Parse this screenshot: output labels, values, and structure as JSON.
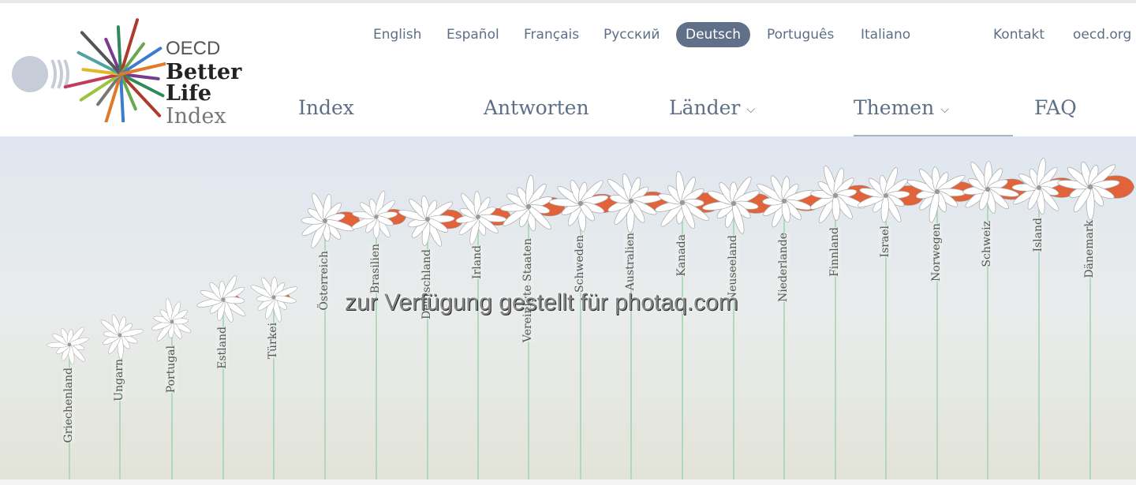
{
  "logo": {
    "oecd": "OECD",
    "line1": "Better Life",
    "line2": "Index"
  },
  "languages": [
    {
      "label": "English",
      "active": false
    },
    {
      "label": "Español",
      "active": false
    },
    {
      "label": "Français",
      "active": false
    },
    {
      "label": "Русский",
      "active": false
    },
    {
      "label": "Deutsch",
      "active": true
    },
    {
      "label": "Português",
      "active": false
    },
    {
      "label": "Italiano",
      "active": false
    }
  ],
  "utility_links": {
    "contact": "Kontakt",
    "site": "oecd.org"
  },
  "nav": [
    {
      "label": "Index",
      "dropdown": false
    },
    {
      "label": "Antworten",
      "dropdown": false
    },
    {
      "label": "Länder",
      "dropdown": true
    },
    {
      "label": "Themen",
      "dropdown": true,
      "active": true
    },
    {
      "label": "FAQ",
      "dropdown": false
    }
  ],
  "countries": [
    "Griechenland",
    "Ungarn",
    "Portugal",
    "Estland",
    "Türkei",
    "Österreich",
    "Brasilien",
    "Deutschland",
    "Irland",
    "Vereinigte Staaten",
    "Schweden",
    "Australien",
    "Kanada",
    "Neuseeland",
    "Niederlande",
    "Finnland",
    "Israel",
    "Norwegen",
    "Schweiz",
    "Island",
    "Dänemark"
  ],
  "colors": {
    "highlight_petal": "#e2623a",
    "petal": "#ffffff",
    "stem": "#9fd3b0",
    "active_lang": "#5f7088",
    "nav_text": "#5d6f86"
  },
  "watermark": "zur Verfügung gestellt für photaq.com"
}
